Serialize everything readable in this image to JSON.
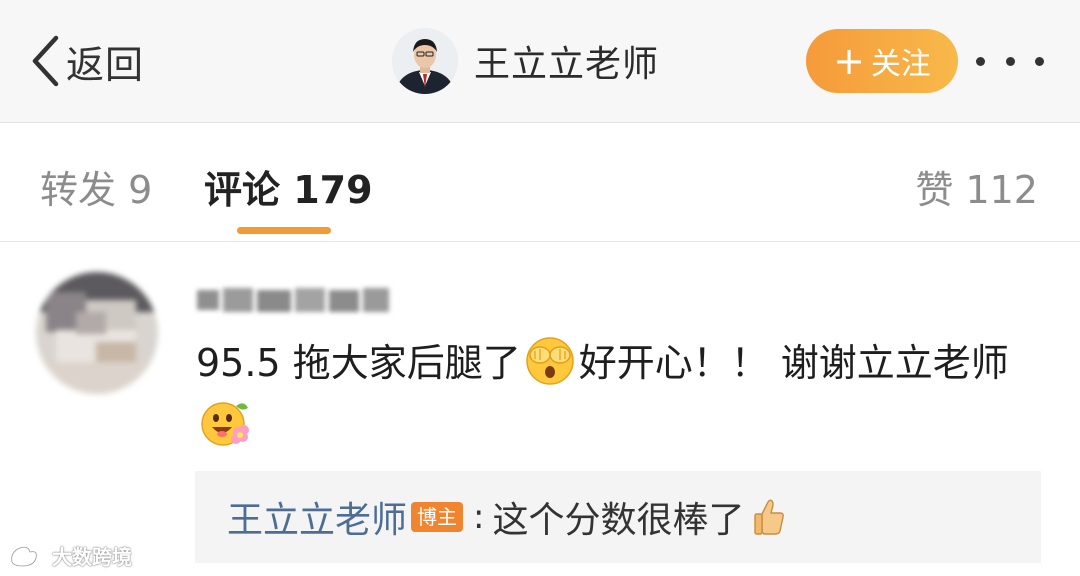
{
  "header": {
    "back_label": "返回",
    "profile_name": "王立立老师",
    "follow_label": "关注",
    "follow_plus": "+"
  },
  "tabs": {
    "repost_label": "转发 9",
    "comment_label": "评论 179",
    "like_label": "赞 112",
    "active_tab": "评论"
  },
  "comment": {
    "text_part1": "95.5 拖大家后腿了",
    "text_part2": "好开心！！ 谢谢立立老师",
    "emoji_1": "covering-eyes-emoji",
    "emoji_2": "flower-face-emoji",
    "reply": {
      "author": "王立立老师",
      "badge": "博主",
      "separator": ":",
      "text": "这个分数很棒了",
      "icon": "thumbs-up-icon"
    }
  },
  "watermark": {
    "text": "大数跨境"
  },
  "colors": {
    "accent_orange": "#f29b36",
    "follow_gradient_start": "#f59a3a",
    "follow_gradient_end": "#f8b94a",
    "reply_author_blue": "#4e6d95",
    "badge_orange": "#f0842f",
    "reply_bg": "#f4f4f4",
    "header_bg": "#f7f7f7"
  }
}
